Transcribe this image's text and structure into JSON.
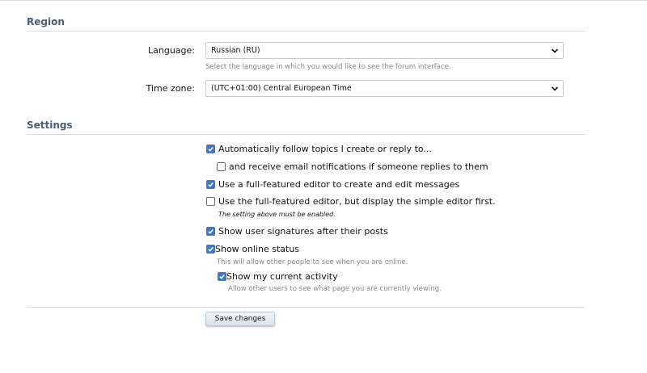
{
  "region": {
    "heading": "Region",
    "language": {
      "label": "Language:",
      "value": "Russian (RU)",
      "hint": "Select the language in which you would like to see the forum interface."
    },
    "timezone": {
      "label": "Time zone:",
      "value": "(UTC+01:00) Central European Time"
    }
  },
  "settings": {
    "heading": "Settings",
    "options": [
      {
        "label": "Automatically follow topics I create or reply to...",
        "checked": true
      },
      {
        "label": "and receive email notifications if someone replies to them",
        "checked": false
      },
      {
        "label": "Use a full-featured editor to create and edit messages",
        "checked": true
      },
      {
        "label": "Use the full-featured editor, but display the simple editor first.",
        "checked": false,
        "note": "The setting above must be enabled."
      },
      {
        "label": "Show user signatures after their posts",
        "checked": true
      },
      {
        "label": "Show online status",
        "checked": true,
        "hint": "This will allow other people to see when you are online."
      },
      {
        "label": "Show my current activity",
        "checked": true,
        "hint": "Allow other users to see what page you are currently viewing."
      }
    ]
  },
  "actions": {
    "save_label": "Save changes"
  },
  "colors": {
    "accent": "#3a7ac6",
    "heading": "#47607a",
    "hint": "#8a8a8a"
  }
}
